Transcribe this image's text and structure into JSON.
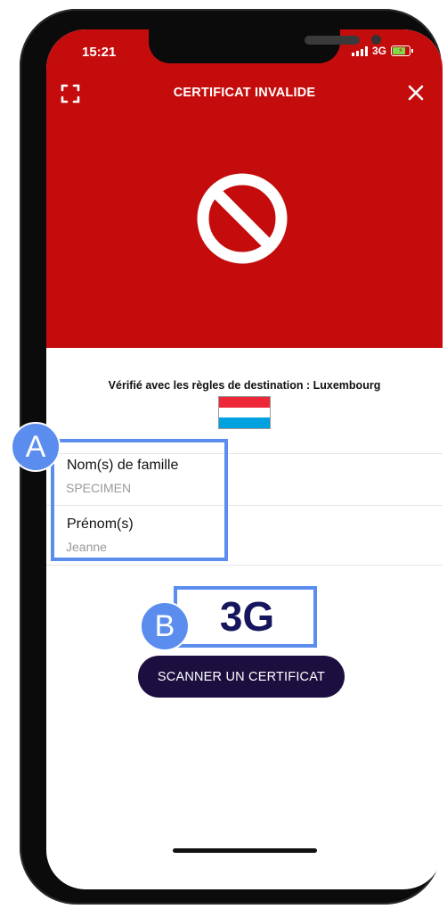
{
  "status_bar": {
    "time": "15:21",
    "network": "3G"
  },
  "header": {
    "title": "CERTIFICAT INVALIDE"
  },
  "result": {
    "icon": "forbidden-icon",
    "color": "#c40c0c"
  },
  "destination": {
    "text": "Vérifié avec les règles de destination : Luxembourg",
    "flag_icon": "luxembourg-flag-icon"
  },
  "fields": [
    {
      "label": "Nom(s) de famille",
      "value": "SPECIMEN"
    },
    {
      "label": "Prénom(s)",
      "value": "Jeanne"
    }
  ],
  "certificate_status": "3G",
  "scan_button_label": "SCANNER UN CERTIFICAT",
  "annotations": {
    "a": "A",
    "b": "B",
    "color": "#5b8def"
  }
}
